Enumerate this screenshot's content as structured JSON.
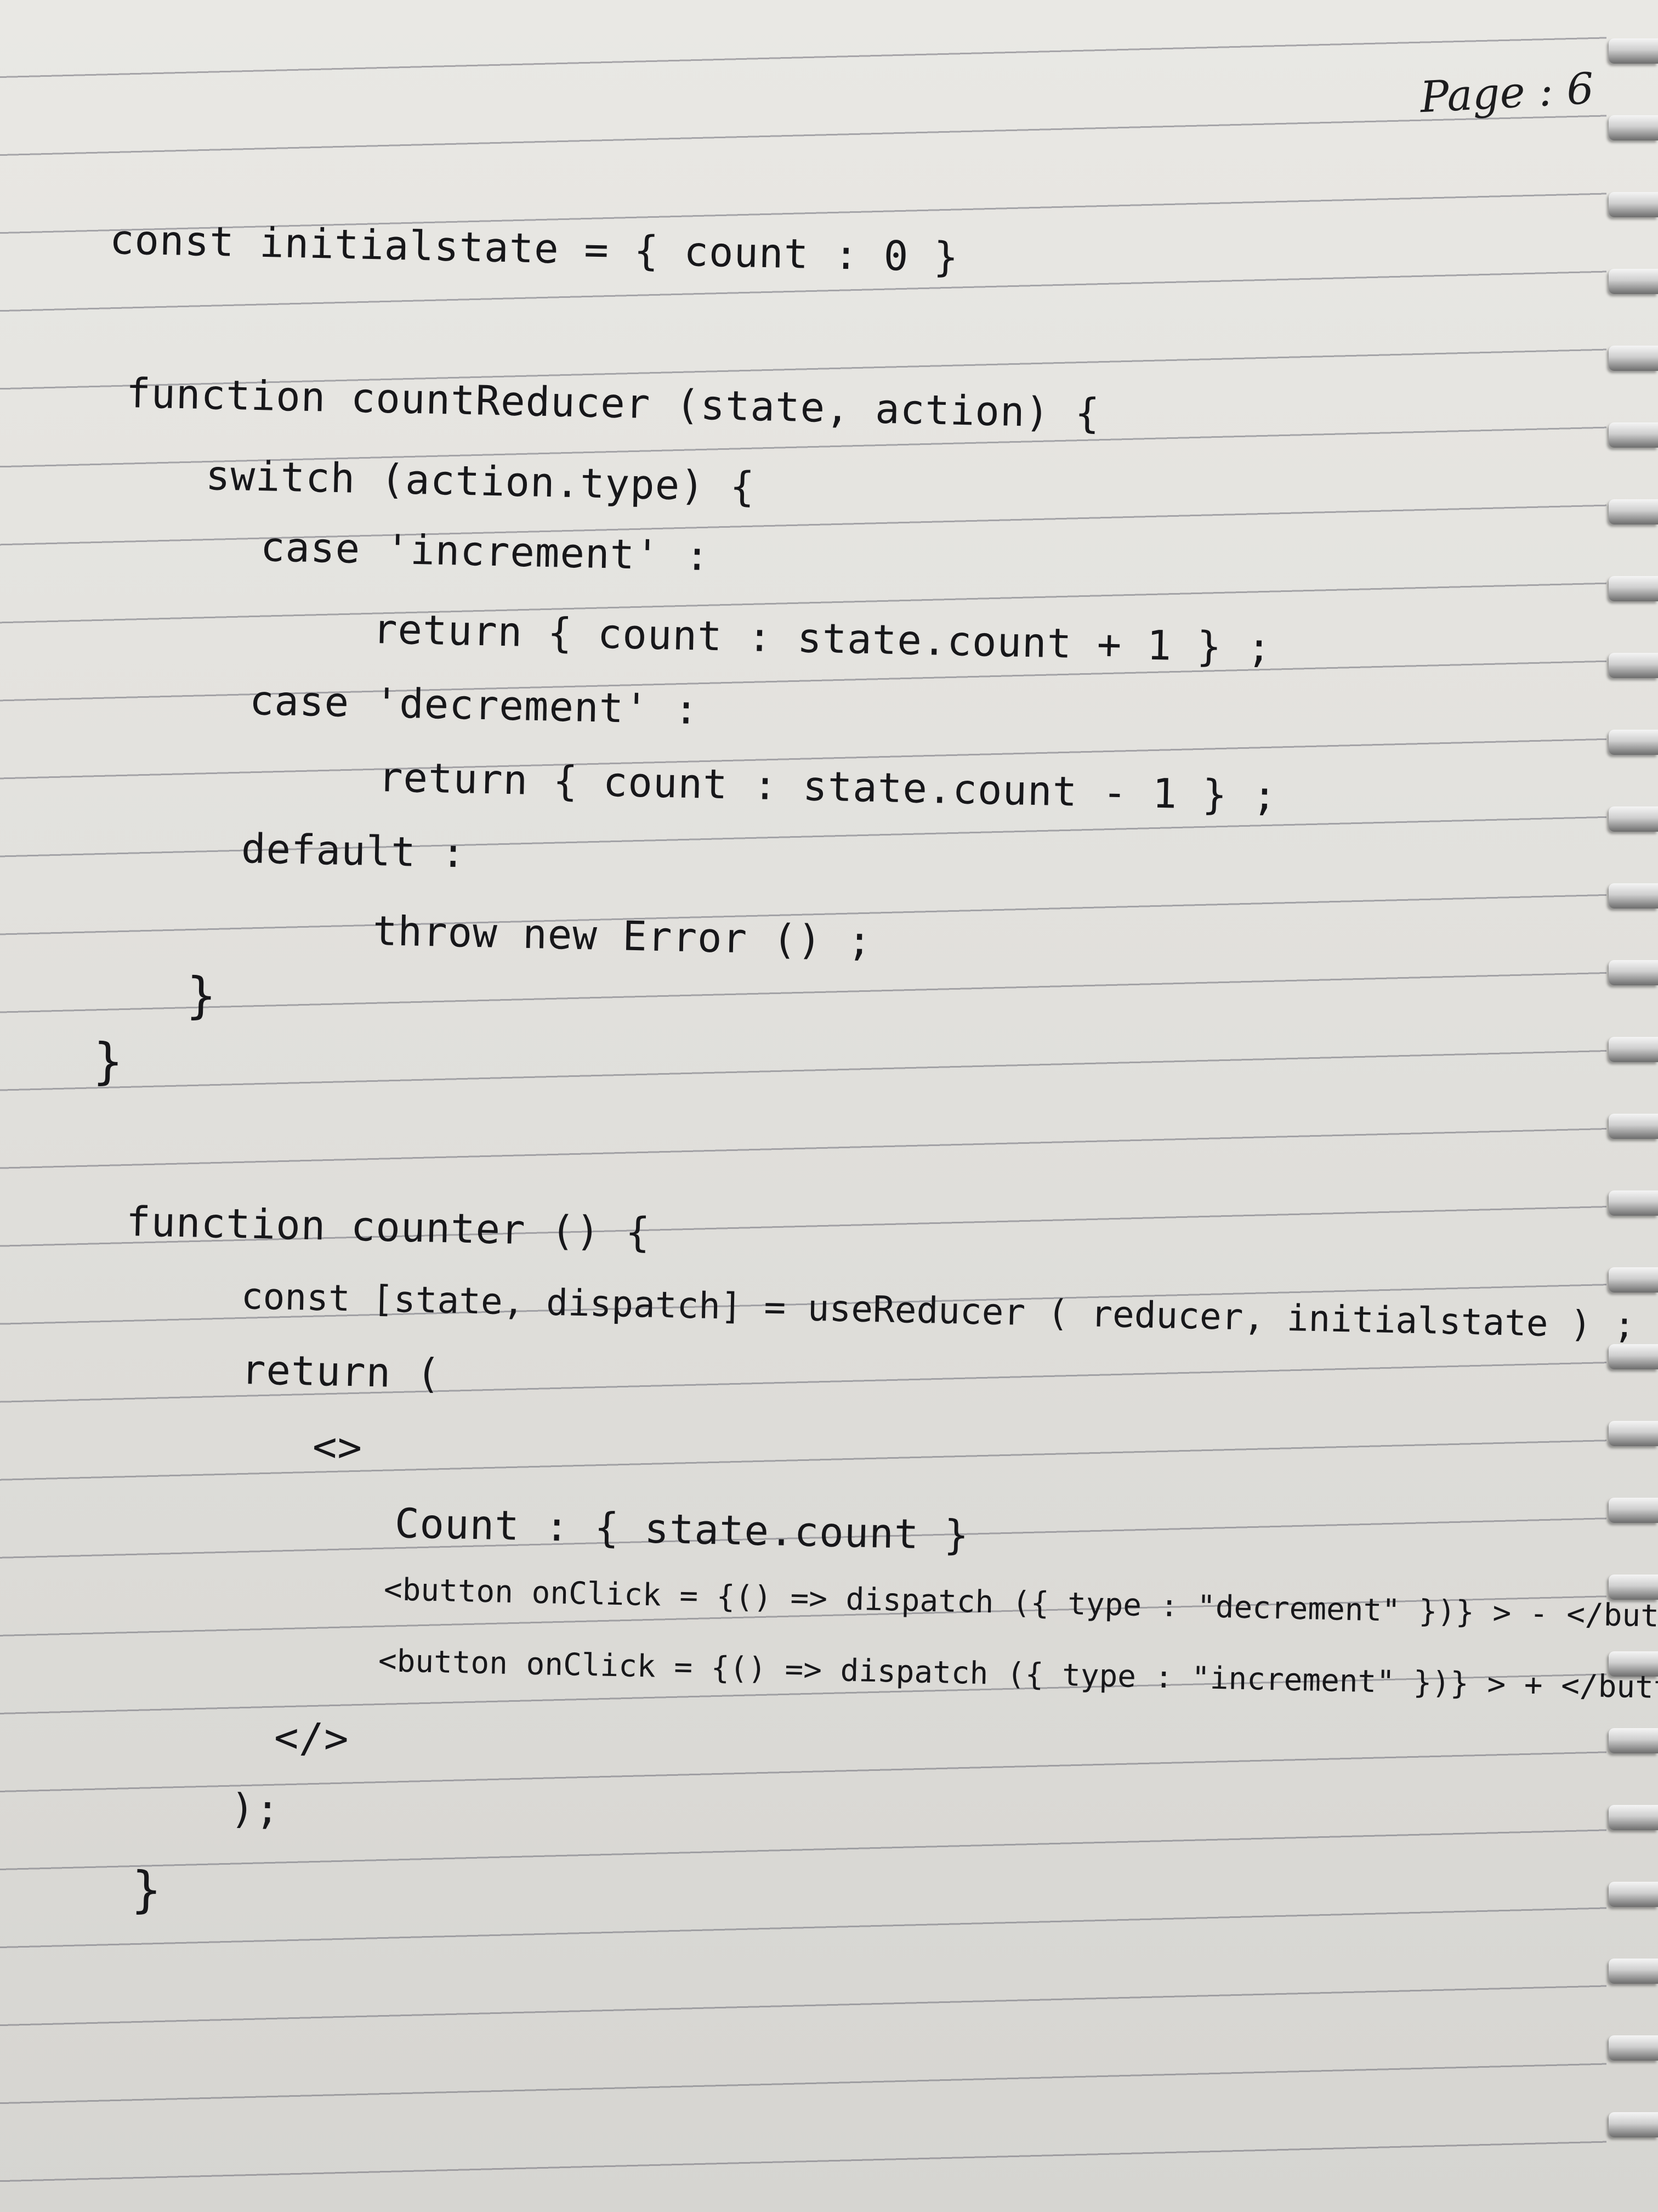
{
  "page_number": "Page : 6",
  "code_lines": [
    "const initialstate = { count : 0 }",
    "function countReducer (state, action) {",
    "switch (action.type) {",
    "case 'increment' :",
    "return { count : state.count + 1 } ;",
    "case 'decrement' :",
    "return { count : state.count - 1 } ;",
    "default :",
    "throw new Error () ;",
    "}",
    "}",
    "function counter () {",
    "const [state, dispatch] = useReducer ( reducer, initialstate ) ;",
    "return (",
    "<>",
    "Count : { state.count }",
    "<button onClick = {() => dispatch ({ type : \"decrement\" })} > - </button>",
    "<button onClick = {() => dispatch ({ type : \"increment\" })} > + </button>",
    "</>",
    ");",
    "}"
  ]
}
